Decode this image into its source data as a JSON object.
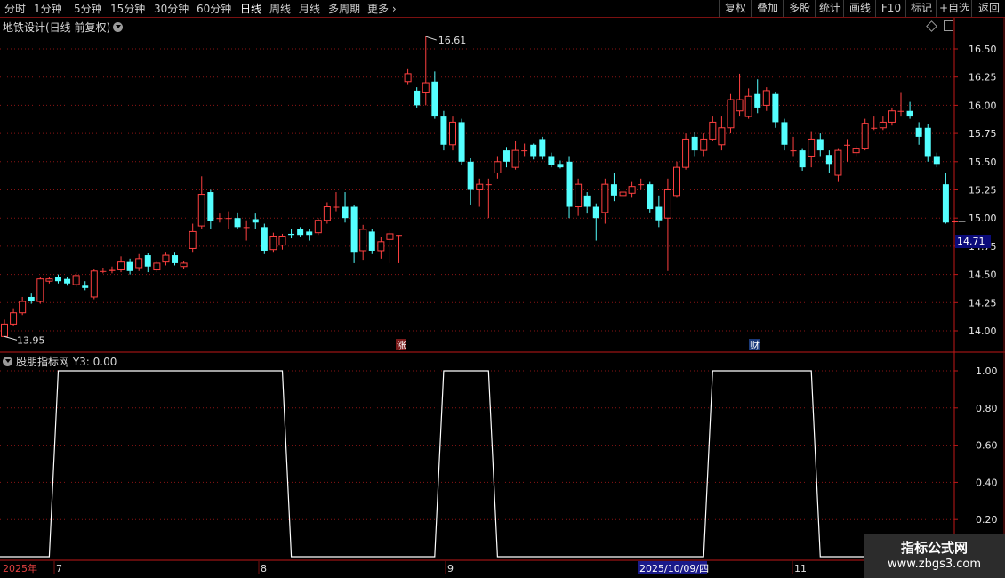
{
  "toolbar": {
    "timeframes": [
      "分时",
      "1分钟",
      "5分钟",
      "15分钟",
      "30分钟",
      "60分钟",
      "日线",
      "周线",
      "月线",
      "多周期",
      "更多"
    ],
    "active": "日线",
    "right_buttons": [
      "复权",
      "叠加",
      "多股",
      "统计",
      "画线",
      "F10",
      "标记",
      "+自选",
      "返回"
    ]
  },
  "chart": {
    "title": "地铁设计(日线 前复权)",
    "high_label": "16.61",
    "low_label": "13.95",
    "current_price": "14.71",
    "marker_zhang": "涨",
    "marker_cai": "财",
    "price_ticks": [
      "16.50",
      "16.25",
      "16.00",
      "15.75",
      "15.50",
      "15.25",
      "15.00",
      "14.75",
      "14.50",
      "14.25",
      "14.00"
    ]
  },
  "indicator": {
    "title": "股朋指标网",
    "value_label": "Y3: 0.00",
    "ticks": [
      "1.00",
      "0.80",
      "0.60",
      "0.40",
      "0.20"
    ]
  },
  "date_axis": {
    "year_label": "2025年",
    "months": [
      "7",
      "8",
      "9",
      "11"
    ],
    "cursor_date": "2025/10/09/四"
  },
  "watermark": {
    "line1": "指标公式网",
    "line2": "www.zbgs3.com"
  },
  "colors": {
    "up": "#ff4040",
    "down": "#54ffff",
    "grid": "#8a1414",
    "indicator_line": "#ffffff"
  },
  "chart_data": {
    "type": "candlestick",
    "title": "地铁设计(日线 前复权)",
    "ylim": [
      13.9,
      16.7
    ],
    "candles": [
      {
        "o": 13.95,
        "c": 14.06,
        "h": 14.1,
        "l": 13.95
      },
      {
        "o": 14.06,
        "c": 14.16,
        "h": 14.2,
        "l": 14.04
      },
      {
        "o": 14.16,
        "c": 14.26,
        "h": 14.3,
        "l": 14.14
      },
      {
        "o": 14.3,
        "c": 14.26,
        "h": 14.33,
        "l": 14.24
      },
      {
        "o": 14.26,
        "c": 14.46,
        "h": 14.48,
        "l": 14.24
      },
      {
        "o": 14.44,
        "c": 14.46,
        "h": 14.48,
        "l": 14.42
      },
      {
        "o": 14.48,
        "c": 14.44,
        "h": 14.5,
        "l": 14.42
      },
      {
        "o": 14.46,
        "c": 14.42,
        "h": 14.48,
        "l": 14.4
      },
      {
        "o": 14.41,
        "c": 14.49,
        "h": 14.52,
        "l": 14.39
      },
      {
        "o": 14.4,
        "c": 14.38,
        "h": 14.44,
        "l": 14.36
      },
      {
        "o": 14.3,
        "c": 14.53,
        "h": 14.55,
        "l": 14.28
      },
      {
        "o": 14.53,
        "c": 14.53,
        "h": 14.56,
        "l": 14.51
      },
      {
        "o": 14.53,
        "c": 14.54,
        "h": 14.57,
        "l": 14.51
      },
      {
        "o": 14.54,
        "c": 14.61,
        "h": 14.66,
        "l": 14.52
      },
      {
        "o": 14.61,
        "c": 14.53,
        "h": 14.64,
        "l": 14.5
      },
      {
        "o": 14.56,
        "c": 14.64,
        "h": 14.68,
        "l": 14.53
      },
      {
        "o": 14.67,
        "c": 14.57,
        "h": 14.69,
        "l": 14.52
      },
      {
        "o": 14.54,
        "c": 14.6,
        "h": 14.62,
        "l": 14.52
      },
      {
        "o": 14.61,
        "c": 14.67,
        "h": 14.7,
        "l": 14.58
      },
      {
        "o": 14.67,
        "c": 14.6,
        "h": 14.7,
        "l": 14.58
      },
      {
        "o": 14.57,
        "c": 14.6,
        "h": 14.62,
        "l": 14.55
      },
      {
        "o": 14.73,
        "c": 14.88,
        "h": 14.95,
        "l": 14.7
      },
      {
        "o": 14.93,
        "c": 15.21,
        "h": 15.37,
        "l": 14.9
      },
      {
        "o": 15.23,
        "c": 14.97,
        "h": 15.25,
        "l": 14.9
      },
      {
        "o": 15.0,
        "c": 15.0,
        "h": 15.04,
        "l": 14.96
      },
      {
        "o": 15.0,
        "c": 15.0,
        "h": 15.06,
        "l": 14.9
      },
      {
        "o": 15.0,
        "c": 14.92,
        "h": 15.05,
        "l": 14.9
      },
      {
        "o": 14.92,
        "c": 14.92,
        "h": 14.98,
        "l": 14.8
      },
      {
        "o": 14.99,
        "c": 14.96,
        "h": 15.04,
        "l": 14.9
      },
      {
        "o": 14.92,
        "c": 14.71,
        "h": 14.95,
        "l": 14.68
      },
      {
        "o": 14.72,
        "c": 14.84,
        "h": 14.87,
        "l": 14.7
      },
      {
        "o": 14.76,
        "c": 14.84,
        "h": 14.86,
        "l": 14.72
      },
      {
        "o": 14.86,
        "c": 14.85,
        "h": 14.9,
        "l": 14.82
      },
      {
        "o": 14.9,
        "c": 14.85,
        "h": 14.92,
        "l": 14.83
      },
      {
        "o": 14.88,
        "c": 14.85,
        "h": 14.9,
        "l": 14.8
      },
      {
        "o": 14.87,
        "c": 14.98,
        "h": 15.0,
        "l": 14.85
      },
      {
        "o": 14.98,
        "c": 15.1,
        "h": 15.14,
        "l": 14.95
      },
      {
        "o": 15.1,
        "c": 15.1,
        "h": 15.23,
        "l": 15.06
      },
      {
        "o": 15.1,
        "c": 15.0,
        "h": 15.23,
        "l": 14.96
      },
      {
        "o": 15.1,
        "c": 14.7,
        "h": 15.12,
        "l": 14.6
      },
      {
        "o": 14.71,
        "c": 14.9,
        "h": 14.94,
        "l": 14.63
      },
      {
        "o": 14.88,
        "c": 14.71,
        "h": 14.9,
        "l": 14.68
      },
      {
        "o": 14.71,
        "c": 14.79,
        "h": 14.83,
        "l": 14.64
      },
      {
        "o": 14.81,
        "c": 14.86,
        "h": 14.89,
        "l": 14.6
      },
      {
        "o": 14.85,
        "c": 14.85,
        "h": 14.85,
        "l": 14.6
      },
      {
        "o": 16.21,
        "c": 16.28,
        "h": 16.32,
        "l": 16.18
      },
      {
        "o": 16.13,
        "c": 16.0,
        "h": 16.16,
        "l": 15.98
      },
      {
        "o": 16.11,
        "c": 16.2,
        "h": 16.61,
        "l": 16.0
      },
      {
        "o": 16.21,
        "c": 15.9,
        "h": 16.3,
        "l": 15.88
      },
      {
        "o": 15.9,
        "c": 15.65,
        "h": 15.95,
        "l": 15.6
      },
      {
        "o": 15.65,
        "c": 15.85,
        "h": 15.9,
        "l": 15.6
      },
      {
        "o": 15.85,
        "c": 15.5,
        "h": 15.88,
        "l": 15.47
      },
      {
        "o": 15.5,
        "c": 15.25,
        "h": 15.53,
        "l": 15.12
      },
      {
        "o": 15.25,
        "c": 15.3,
        "h": 15.35,
        "l": 15.1
      },
      {
        "o": 15.3,
        "c": 15.3,
        "h": 15.35,
        "l": 15.0
      },
      {
        "o": 15.4,
        "c": 15.5,
        "h": 15.55,
        "l": 15.35
      },
      {
        "o": 15.6,
        "c": 15.5,
        "h": 15.63,
        "l": 15.45
      },
      {
        "o": 15.45,
        "c": 15.6,
        "h": 15.68,
        "l": 15.43
      },
      {
        "o": 15.6,
        "c": 15.6,
        "h": 15.66,
        "l": 15.55
      },
      {
        "o": 15.65,
        "c": 15.55,
        "h": 15.66,
        "l": 15.52
      },
      {
        "o": 15.7,
        "c": 15.55,
        "h": 15.72,
        "l": 15.52
      },
      {
        "o": 15.55,
        "c": 15.47,
        "h": 15.58,
        "l": 15.45
      },
      {
        "o": 15.48,
        "c": 15.45,
        "h": 15.51,
        "l": 15.44
      },
      {
        "o": 15.5,
        "c": 15.1,
        "h": 15.55,
        "l": 15.0
      },
      {
        "o": 15.1,
        "c": 15.3,
        "h": 15.35,
        "l": 15.02
      },
      {
        "o": 15.2,
        "c": 15.1,
        "h": 15.23,
        "l": 15.04
      },
      {
        "o": 15.1,
        "c": 15.0,
        "h": 15.13,
        "l": 14.8
      },
      {
        "o": 15.05,
        "c": 15.3,
        "h": 15.35,
        "l": 14.95
      },
      {
        "o": 15.3,
        "c": 15.2,
        "h": 15.4,
        "l": 15.15
      },
      {
        "o": 15.2,
        "c": 15.23,
        "h": 15.27,
        "l": 15.18
      },
      {
        "o": 15.22,
        "c": 15.28,
        "h": 15.32,
        "l": 15.18
      },
      {
        "o": 15.3,
        "c": 15.3,
        "h": 15.35,
        "l": 15.25
      },
      {
        "o": 15.3,
        "c": 15.08,
        "h": 15.32,
        "l": 15.05
      },
      {
        "o": 15.1,
        "c": 14.98,
        "h": 15.2,
        "l": 14.92
      },
      {
        "o": 15.0,
        "c": 15.25,
        "h": 15.35,
        "l": 14.53
      },
      {
        "o": 15.2,
        "c": 15.45,
        "h": 15.5,
        "l": 15.18
      },
      {
        "o": 15.45,
        "c": 15.7,
        "h": 15.75,
        "l": 15.43
      },
      {
        "o": 15.72,
        "c": 15.6,
        "h": 15.76,
        "l": 15.55
      },
      {
        "o": 15.6,
        "c": 15.7,
        "h": 15.75,
        "l": 15.55
      },
      {
        "o": 15.7,
        "c": 15.85,
        "h": 15.9,
        "l": 15.68
      },
      {
        "o": 15.65,
        "c": 15.8,
        "h": 15.9,
        "l": 15.6
      },
      {
        "o": 15.8,
        "c": 16.05,
        "h": 16.1,
        "l": 15.75
      },
      {
        "o": 15.95,
        "c": 16.05,
        "h": 16.28,
        "l": 15.9
      },
      {
        "o": 15.9,
        "c": 16.08,
        "h": 16.15,
        "l": 15.88
      },
      {
        "o": 16.1,
        "c": 15.98,
        "h": 16.23,
        "l": 15.93
      },
      {
        "o": 16.0,
        "c": 16.13,
        "h": 16.16,
        "l": 15.95
      },
      {
        "o": 16.1,
        "c": 15.85,
        "h": 16.12,
        "l": 15.8
      },
      {
        "o": 15.85,
        "c": 15.65,
        "h": 15.88,
        "l": 15.6
      },
      {
        "o": 15.6,
        "c": 15.6,
        "h": 15.72,
        "l": 15.55
      },
      {
        "o": 15.6,
        "c": 15.45,
        "h": 15.62,
        "l": 15.42
      },
      {
        "o": 15.55,
        "c": 15.7,
        "h": 15.77,
        "l": 15.45
      },
      {
        "o": 15.7,
        "c": 15.6,
        "h": 15.75,
        "l": 15.55
      },
      {
        "o": 15.56,
        "c": 15.48,
        "h": 15.6,
        "l": 15.4
      },
      {
        "o": 15.38,
        "c": 15.6,
        "h": 15.62,
        "l": 15.32
      },
      {
        "o": 15.65,
        "c": 15.65,
        "h": 15.7,
        "l": 15.5
      },
      {
        "o": 15.58,
        "c": 15.62,
        "h": 15.64,
        "l": 15.55
      },
      {
        "o": 15.62,
        "c": 15.84,
        "h": 15.88,
        "l": 15.6
      },
      {
        "o": 15.8,
        "c": 15.8,
        "h": 15.9,
        "l": 15.78
      },
      {
        "o": 15.8,
        "c": 15.85,
        "h": 15.9,
        "l": 15.78
      },
      {
        "o": 15.85,
        "c": 15.95,
        "h": 15.98,
        "l": 15.82
      },
      {
        "o": 15.95,
        "c": 15.95,
        "h": 16.11,
        "l": 15.9
      },
      {
        "o": 15.95,
        "c": 15.9,
        "h": 16.03,
        "l": 15.88
      },
      {
        "o": 15.8,
        "c": 15.72,
        "h": 15.85,
        "l": 15.65
      },
      {
        "o": 15.8,
        "c": 15.55,
        "h": 15.83,
        "l": 15.5
      },
      {
        "o": 15.55,
        "c": 15.48,
        "h": 15.58,
        "l": 15.45
      },
      {
        "o": 15.3,
        "c": 14.96,
        "h": 15.4,
        "l": 14.95
      },
      {
        "o": 14.97,
        "c": 14.97,
        "h": 14.98,
        "l": 14.96
      }
    ],
    "indicator_series": {
      "name": "Y3",
      "ylim": [
        0,
        1.0
      ],
      "pairs": [
        [
          0,
          0
        ],
        [
          5,
          0
        ],
        [
          6,
          1
        ],
        [
          31,
          1
        ],
        [
          32,
          0
        ],
        [
          48,
          0
        ],
        [
          49,
          1
        ],
        [
          54,
          1
        ],
        [
          55,
          0
        ],
        [
          78,
          0
        ],
        [
          79,
          1
        ],
        [
          90,
          1
        ],
        [
          91,
          0
        ],
        [
          104,
          0
        ]
      ]
    }
  }
}
